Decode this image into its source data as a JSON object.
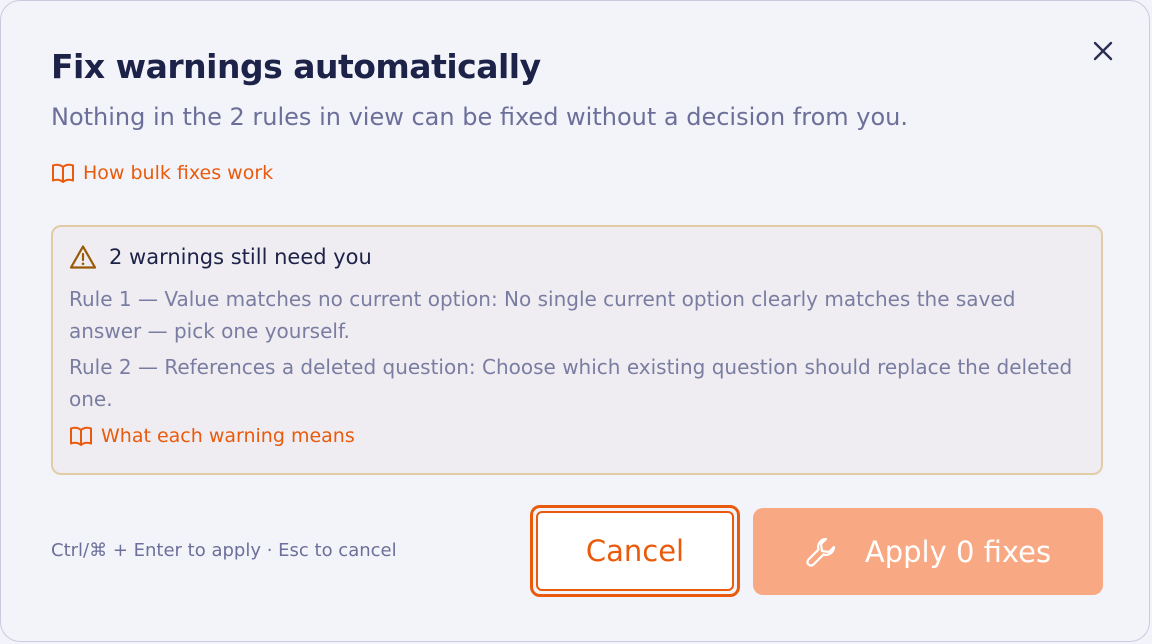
{
  "dialog": {
    "title": "Fix warnings automatically",
    "subtitle": "Nothing in the 2 rules in view can be fixed without a decision from you.",
    "help_link": "How bulk fixes work",
    "close_icon": "close-icon"
  },
  "warnings": {
    "heading": "2 warnings still need you",
    "rules": [
      "Rule 1 — Value matches no current option: No single current option clearly matches the saved answer — pick one yourself.",
      "Rule 2 — References a deleted question: Choose which existing question should replace the deleted one."
    ],
    "link": "What each warning means",
    "icon": "warning-triangle-icon"
  },
  "footer": {
    "shortcut_hint": "Ctrl/⌘ + Enter to apply · Esc to cancel",
    "cancel_label": "Cancel",
    "apply_label": "Apply 0 fixes",
    "apply_icon": "wrench-icon"
  },
  "colors": {
    "accent": "#ea5a0c",
    "title": "#1c2248",
    "muted": "#6c6f9a",
    "warning_border": "#e2cca6",
    "apply_disabled": "#f8a983"
  }
}
